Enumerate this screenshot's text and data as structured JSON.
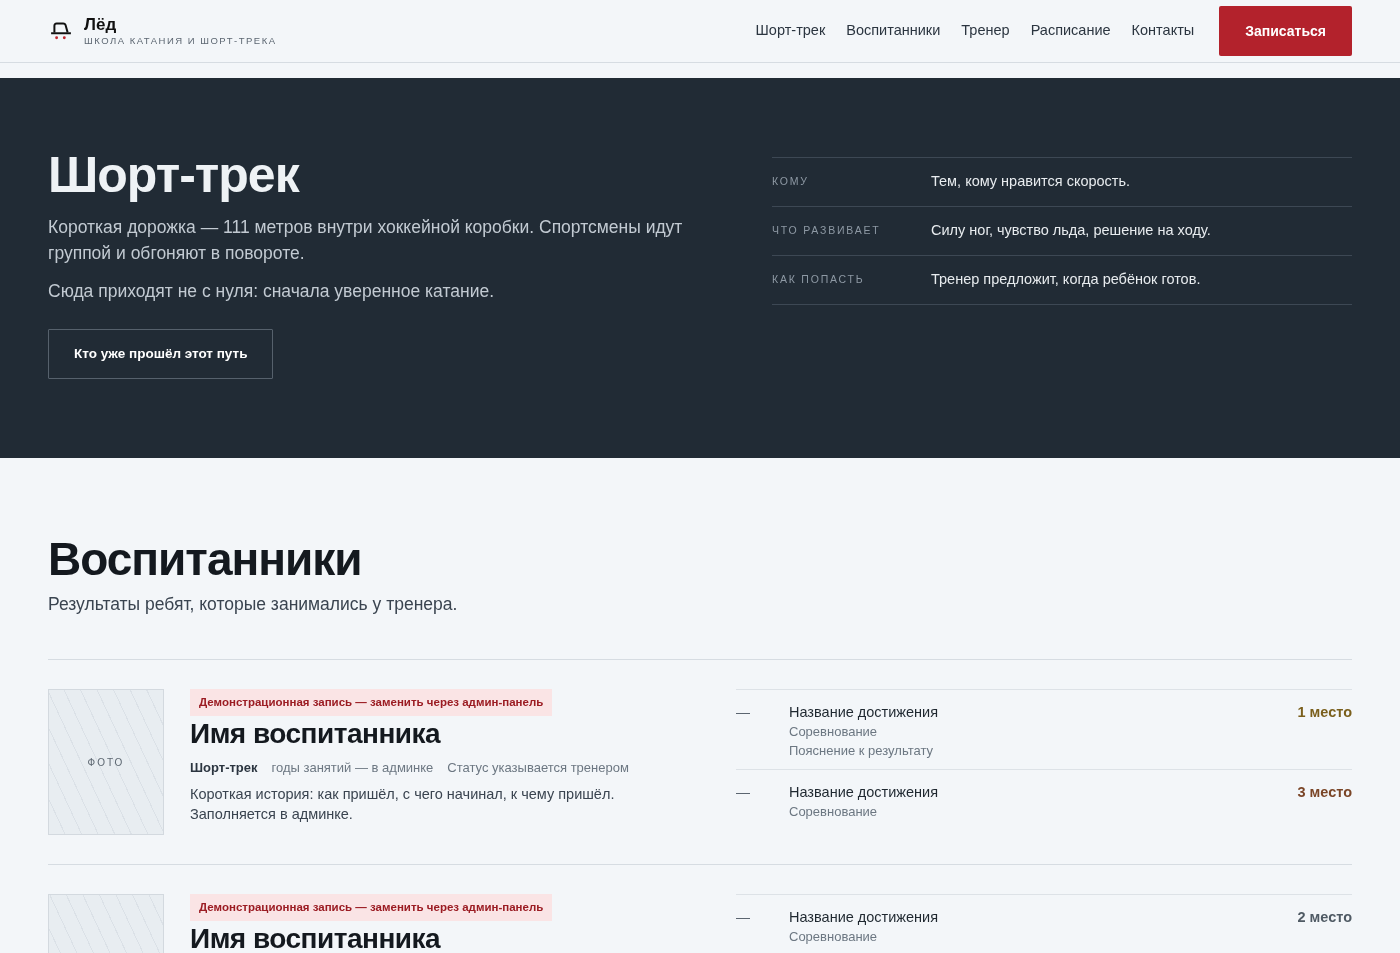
{
  "header": {
    "logo": {
      "title": "Лёд",
      "subtitle": "ШКОЛА КАТАНИЯ И ШОРТ-ТРЕКА"
    },
    "nav": [
      {
        "label": "Шорт-трек"
      },
      {
        "label": "Воспитанники"
      },
      {
        "label": "Тренер"
      },
      {
        "label": "Расписание"
      },
      {
        "label": "Контакты"
      }
    ],
    "cta": "Записаться"
  },
  "hero": {
    "title": "Шорт-трек",
    "paragraphs": [
      "Короткая дорожка — 111 метров внутри хоккейной коробки. Спортсмены идут группой и обгоняют в повороте.",
      "Сюда приходят не с нуля: сначала уверенное катание."
    ],
    "button": "Кто уже прошёл этот путь",
    "facts": [
      {
        "label": "КОМУ",
        "value": "Тем, кому нравится скорость."
      },
      {
        "label": "ЧТО РАЗВИВАЕТ",
        "value": "Силу ног, чувство льда, решение на ходу."
      },
      {
        "label": "КАК ПОПАСТЬ",
        "value": "Тренер предложит, когда ребёнок готов."
      }
    ]
  },
  "students": {
    "title": "Воспитанники",
    "subtitle": "Результаты ребят, которые занимались у тренера.",
    "items": [
      {
        "photo_label": "ФОТО",
        "badge": "Демонстрационная запись — заменить через админ-панель",
        "name": "Имя воспитанника",
        "discipline": "Шорт-трек",
        "years": "годы занятий — в админке",
        "status": "Статус указывается тренером",
        "story": "Короткая история: как пришёл, с чего начинал, к чему пришёл. Заполняется в админке.",
        "achievements": [
          {
            "marker": "—",
            "title": "Название достижения",
            "competition": "Соревнование",
            "note": "Пояснение к результату",
            "place": "1 место",
            "color": "#7a5f1c"
          },
          {
            "marker": "—",
            "title": "Название достижения",
            "competition": "Соревнование",
            "place": "3 место",
            "color": "#7a4527"
          }
        ]
      },
      {
        "badge": "Демонстрационная запись — заменить через админ-панель",
        "name": "Имя воспитанника",
        "achievements": [
          {
            "marker": "—",
            "title": "Название достижения",
            "competition": "Соревнование",
            "place": "2 место",
            "color": "#4f5a64"
          }
        ]
      }
    ]
  }
}
